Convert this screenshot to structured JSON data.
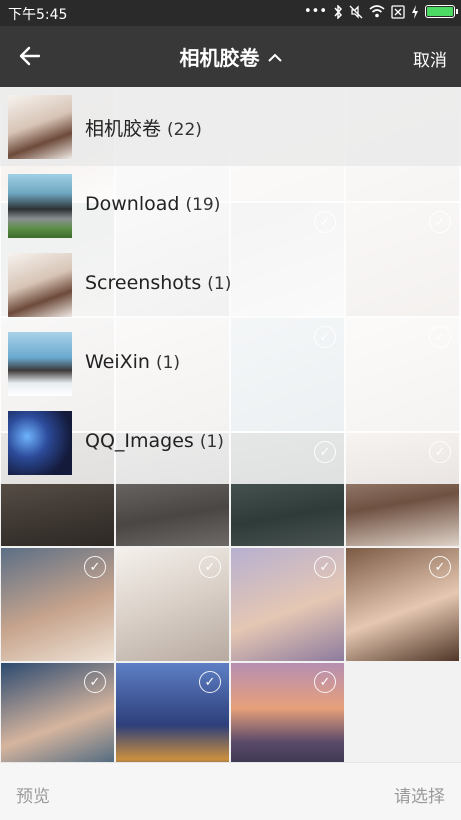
{
  "status_bar": {
    "time": "下午5:45",
    "icons": [
      "more-dots-icon",
      "bluetooth-icon",
      "mute-icon",
      "wifi-icon",
      "sim-x-icon",
      "charging-icon",
      "battery-icon"
    ],
    "battery_level": 1.0,
    "battery_color": "#4cd964"
  },
  "header": {
    "back_icon": "arrow-left-icon",
    "title": "相机胶卷",
    "title_chevron": "chevron-up-icon",
    "cancel_label": "取消"
  },
  "albums": [
    {
      "name": "相机胶卷",
      "count": "(22)",
      "selected": true
    },
    {
      "name": "Download",
      "count": "(19)",
      "selected": false
    },
    {
      "name": "Screenshots",
      "count": "(1)",
      "selected": false
    },
    {
      "name": "WeiXin",
      "count": "(1)",
      "selected": false
    },
    {
      "name": "QQ_Images",
      "count": "(1)",
      "selected": false
    }
  ],
  "bottom_bar": {
    "preview_label": "预览",
    "select_label": "请选择"
  },
  "colors": {
    "status_bar_bg": "#2a2a2a",
    "title_bar_bg": "#383838",
    "bottom_bar_text": "#9a9a9a"
  }
}
